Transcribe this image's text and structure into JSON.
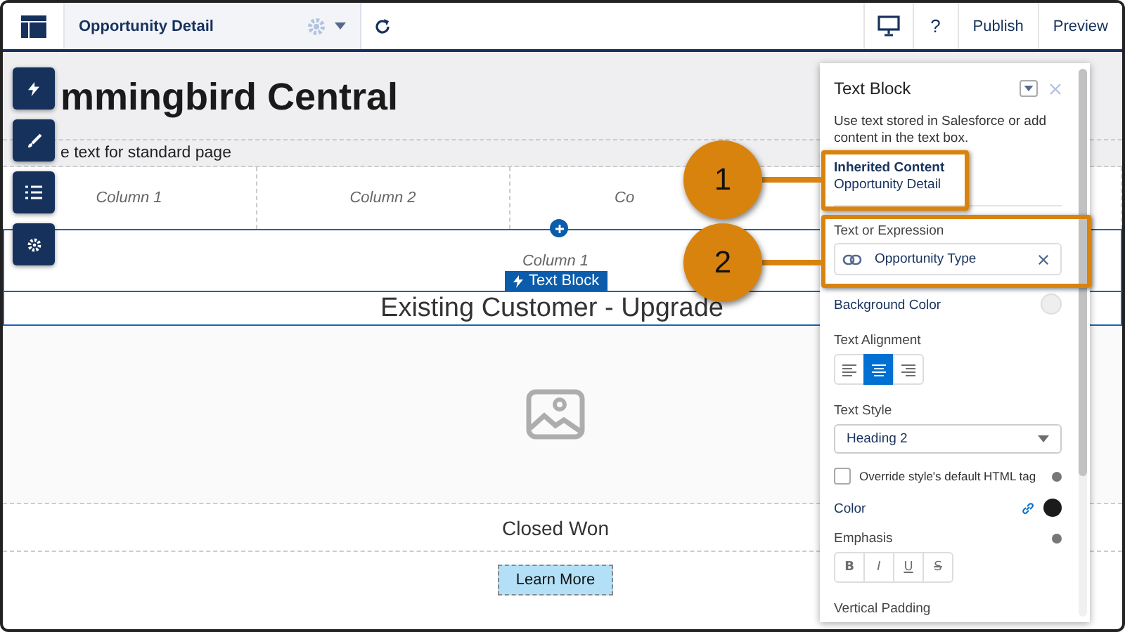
{
  "top_bar": {
    "page_name": "Opportunity Detail",
    "help": "?",
    "buttons": [
      "Publish",
      "Preview"
    ]
  },
  "page": {
    "title": "mmingbird Central",
    "subtitle": "e text for standard page",
    "columns": [
      "Column 1",
      "Column 2",
      "Co"
    ],
    "section": {
      "column_label": "Column 1",
      "tag": "Text Block",
      "heading": "Existing Customer - Upgrade"
    },
    "stage": "Closed Won",
    "button": "Learn More"
  },
  "panel": {
    "title": "Text Block",
    "description": "Use text stored in Salesforce or add content in the text box.",
    "inherited": {
      "label": "Inherited Content",
      "value": "Opportunity Detail"
    },
    "expression": {
      "label": "Text or Expression",
      "value": "Opportunity Type"
    },
    "background": {
      "label": "Background Color",
      "color": "#eeeeee"
    },
    "alignment": {
      "label": "Text Alignment",
      "options": [
        {
          "kind": "left",
          "selected": false
        },
        {
          "kind": "center",
          "selected": true
        },
        {
          "kind": "right",
          "selected": false
        }
      ]
    },
    "text_style": {
      "label": "Text Style",
      "value": "Heading 2"
    },
    "override": {
      "label": "Override style's default HTML tag",
      "checked": false
    },
    "color": {
      "label": "Color",
      "color": "#1b1b1b"
    },
    "emphasis": {
      "label": "Emphasis",
      "options": [
        {
          "kind": "bold",
          "glyph": "B",
          "selected": false
        },
        {
          "kind": "italic",
          "glyph": "I",
          "selected": false
        },
        {
          "kind": "underline",
          "glyph": "U",
          "selected": false
        },
        {
          "kind": "strike",
          "glyph": "S",
          "selected": false
        }
      ]
    },
    "next_label": "Vertical Padding"
  },
  "callouts": [
    "1",
    "2"
  ]
}
